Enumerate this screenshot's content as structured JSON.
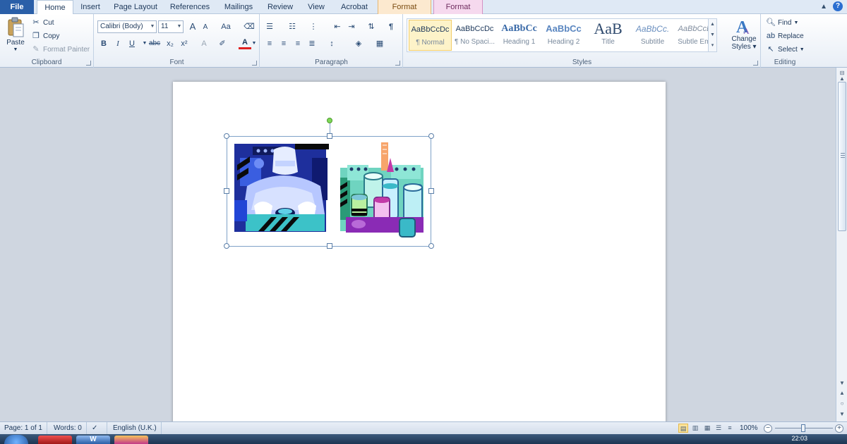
{
  "tabs": {
    "file": "File",
    "home": "Home",
    "insert": "Insert",
    "page_layout": "Page Layout",
    "references": "References",
    "mailings": "Mailings",
    "review": "Review",
    "view": "View",
    "acrobat": "Acrobat",
    "format_1": "Format",
    "format_2": "Format"
  },
  "clipboard": {
    "paste": "Paste",
    "cut": "Cut",
    "copy": "Copy",
    "format_painter": "Format Painter",
    "label": "Clipboard"
  },
  "font": {
    "name": "Calibri (Body)",
    "size": "11",
    "grow": "A",
    "shrink": "A",
    "change_case": "Aa",
    "bold": "B",
    "italic": "I",
    "underline": "U",
    "strikethrough": "abc",
    "subscript": "x₂",
    "superscript": "x²",
    "font_color": "A",
    "label": "Font"
  },
  "paragraph": {
    "show_hide": "¶",
    "label": "Paragraph"
  },
  "styles": {
    "items": [
      {
        "sample": "AaBbCcDc",
        "name": "¶ Normal"
      },
      {
        "sample": "AaBbCcDc",
        "name": "¶ No Spaci..."
      },
      {
        "sample": "AaBbCc",
        "name": "Heading 1"
      },
      {
        "sample": "AaBbCc",
        "name": "Heading 2"
      },
      {
        "sample": "AaB",
        "name": "Title"
      },
      {
        "sample": "AaBbCc.",
        "name": "Subtitle"
      },
      {
        "sample": "AaBbCcDc",
        "name": "Subtle Em..."
      }
    ],
    "change_styles_line1": "Change",
    "change_styles_line2": "Styles",
    "label": "Styles"
  },
  "editing": {
    "find": "Find",
    "replace": "Replace",
    "select": "Select",
    "label": "Editing"
  },
  "status": {
    "page": "Page: 1 of 1",
    "words": "Words: 0",
    "language": "English (U.K.)",
    "zoom": "100%"
  },
  "taskbar": {
    "clock": "22:03"
  },
  "colors": {
    "file_tab": "#2a5fa8",
    "format_tab_1": "#fce9cf",
    "format_tab_2": "#f6d9ee",
    "rotate_handle": "#7ed957"
  }
}
